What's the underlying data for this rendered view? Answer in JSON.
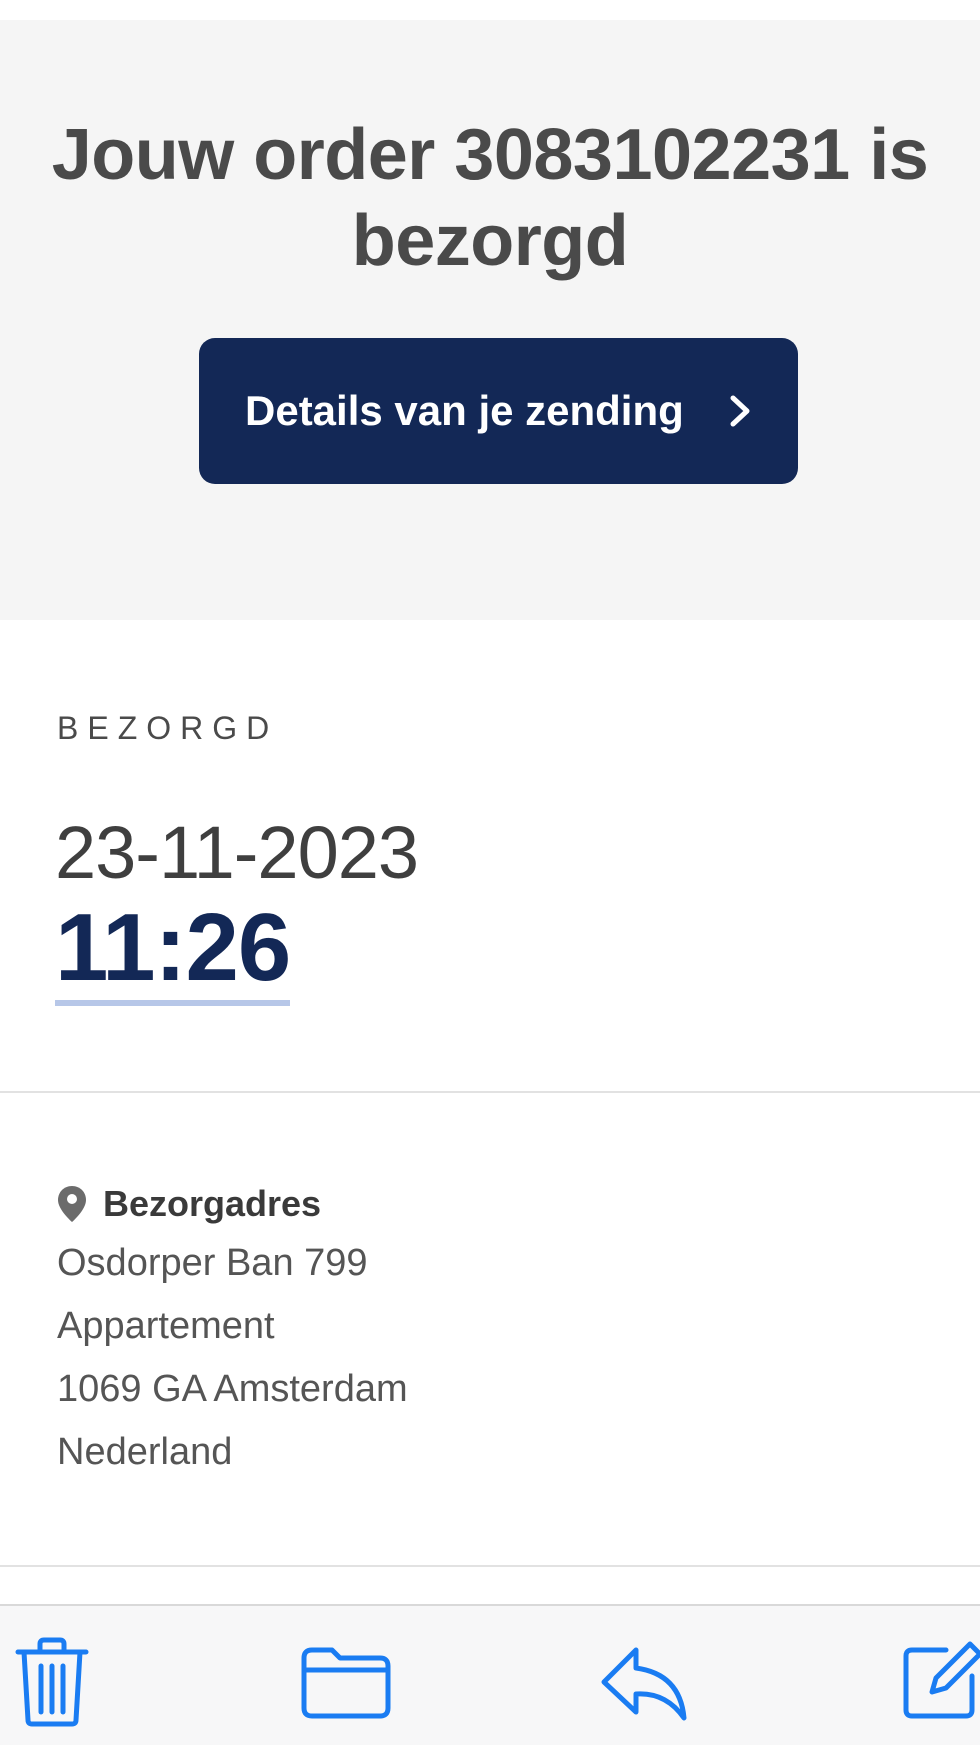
{
  "header": {
    "title": "Jouw order 3083102231 is bezorgd",
    "details_button_label": "Details van je zending"
  },
  "status": {
    "label": "BEZORGD",
    "date": "23-11-2023",
    "time": "11:26"
  },
  "address": {
    "heading": "Bezorgadres",
    "lines": [
      "Osdorper Ban 799",
      "Appartement",
      "1069 GA Amsterdam",
      "Nederland"
    ]
  },
  "toolbar": {
    "buttons": [
      "trash-icon",
      "folder-icon",
      "reply-icon",
      "compose-icon"
    ]
  },
  "colors": {
    "brand_navy": "#132856",
    "toolbar_blue": "#1a7cf2",
    "hero_background": "#f5f5f5",
    "time_underline": "#b7c7e8"
  }
}
